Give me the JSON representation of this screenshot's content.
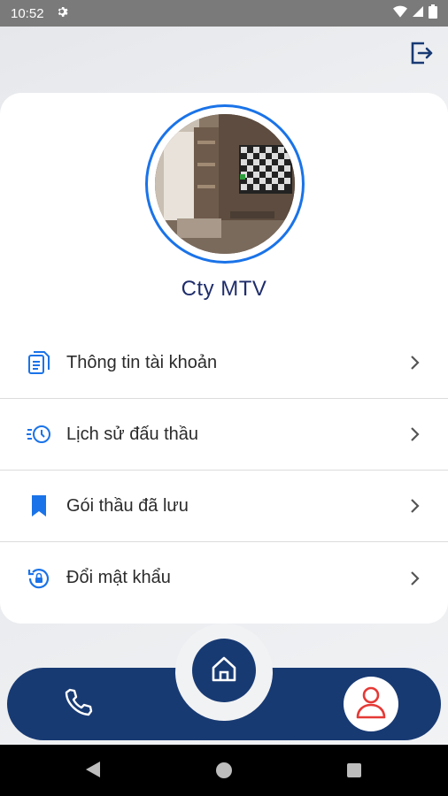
{
  "status_bar": {
    "time": "10:52"
  },
  "profile": {
    "company_name": "Cty MTV"
  },
  "menu": {
    "items": [
      {
        "label": "Thông tin tài khoản",
        "icon": "document-icon"
      },
      {
        "label": "Lịch sử đấu thầu",
        "icon": "history-icon"
      },
      {
        "label": "Gói thầu đã lưu",
        "icon": "bookmark-icon"
      },
      {
        "label": "Đổi mật khẩu",
        "icon": "lock-reset-icon"
      }
    ]
  },
  "bottom_nav": {
    "items": [
      "phone-icon",
      "home-icon",
      "profile-icon"
    ],
    "active": "profile-icon"
  },
  "colors": {
    "accent_blue": "#1a73e8",
    "navy": "#183a73",
    "title_navy": "#1f2d6b",
    "active_red": "#e53935"
  }
}
